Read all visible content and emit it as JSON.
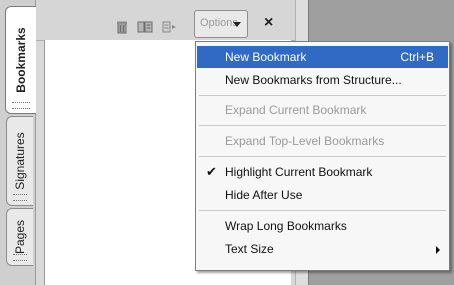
{
  "tabs": [
    {
      "label": "Bookmarks",
      "active": true
    },
    {
      "label": "Signatures",
      "active": false
    },
    {
      "label": "Pages",
      "active": false
    }
  ],
  "toolbar": {
    "icons": [
      "trash-icon",
      "bookmark-properties-icon",
      "expand-bookmark-icon"
    ],
    "options_label": "Options",
    "close_label": "×"
  },
  "menu": {
    "items": [
      {
        "label": "New Bookmark",
        "shortcut": "Ctrl+B",
        "state": "highlighted"
      },
      {
        "label": "New Bookmarks from Structure...",
        "state": "enabled"
      },
      {
        "label": "Expand Current Bookmark",
        "state": "disabled"
      },
      {
        "label": "Expand Top-Level Bookmarks",
        "state": "disabled"
      },
      {
        "label": "Highlight Current Bookmark",
        "state": "checked"
      },
      {
        "label": "Hide After Use",
        "state": "enabled"
      },
      {
        "label": "Wrap Long Bookmarks",
        "state": "enabled"
      },
      {
        "label": "Text Size",
        "state": "submenu"
      }
    ]
  },
  "colors": {
    "highlight": "#316ac5",
    "disabled_text": "#9a9a9a"
  }
}
